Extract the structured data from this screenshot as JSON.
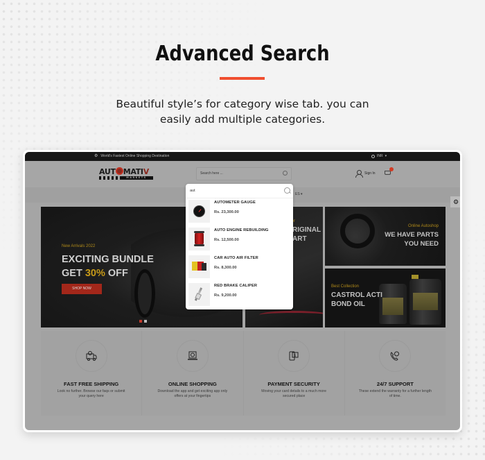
{
  "hero": {
    "title": "Advanced Search",
    "subtitle_line1": "Beautiful style’s for category wise tab. you can",
    "subtitle_line2": "easily add multiple categories.",
    "accent_color": "#f04e2f"
  },
  "site": {
    "topbar": {
      "promo_text": "World's Fastest Online Shopping Destination",
      "currency": "INR"
    },
    "header": {
      "logo_text_left": "AUT",
      "logo_text_right": "MATI",
      "logo_text_v": "V",
      "logo_subtitle": "MARKETS",
      "search_placeholder": "Search here ...",
      "signin_label": "Sign In",
      "cart_badge_color": "#d23a22"
    },
    "nav": {
      "partial_item": "ES"
    },
    "search_dropdown": {
      "query": "aut",
      "results": [
        {
          "name": "AUTOMETER GAUGE",
          "price": "Rs. 23,300.00",
          "thumb": "gauge"
        },
        {
          "name": "AUTO ENGINE REBUILDING",
          "price": "Rs. 12,500.00",
          "thumb": "air-filter"
        },
        {
          "name": "CAR AUTO AIR FILTER",
          "price": "Rs. 8,300.00",
          "thumb": "parts-boxes"
        },
        {
          "name": "RED BRAKE CALIPER",
          "price": "Rs. 9,200.00",
          "thumb": "spark-plug"
        }
      ]
    },
    "banners": {
      "main": {
        "kicker": "New Arrivals 2022",
        "line1": "EXCITING BUNDLE",
        "line2_pre": "GET ",
        "line2_highlight": "30%",
        "line2_post": " OFF",
        "button_label": "SHOP NOW",
        "slides": 2,
        "active_slide": 1
      },
      "middle": {
        "kicker": "fer",
        "line1": "RIGINAL",
        "line2": "ART"
      },
      "top_right": {
        "kicker": "Online Autoshop",
        "line1": "WE HAVE PARTS",
        "line2": "YOU NEED"
      },
      "bottom_right": {
        "kicker": "Best Collection",
        "line1": "CASTROL ACTI",
        "line2": "BOND OIL"
      }
    },
    "features": [
      {
        "icon": "delivery-truck-icon",
        "title": "FAST FREE SHIPPING",
        "desc": "Look no further. Browse our faqs or submit your query here"
      },
      {
        "icon": "laptop-shopping-icon",
        "title": "ONLINE SHOPPING",
        "desc": "Download the app and get exciting app only offers at your fingertips"
      },
      {
        "icon": "payment-security-icon",
        "title": "PAYMENT SECURITY",
        "desc": "Moving your card details to a much more secured place"
      },
      {
        "icon": "support-phone-icon",
        "title": "24/7 SUPPORT",
        "desc": "These extend the warranty for a further length of time."
      }
    ]
  }
}
